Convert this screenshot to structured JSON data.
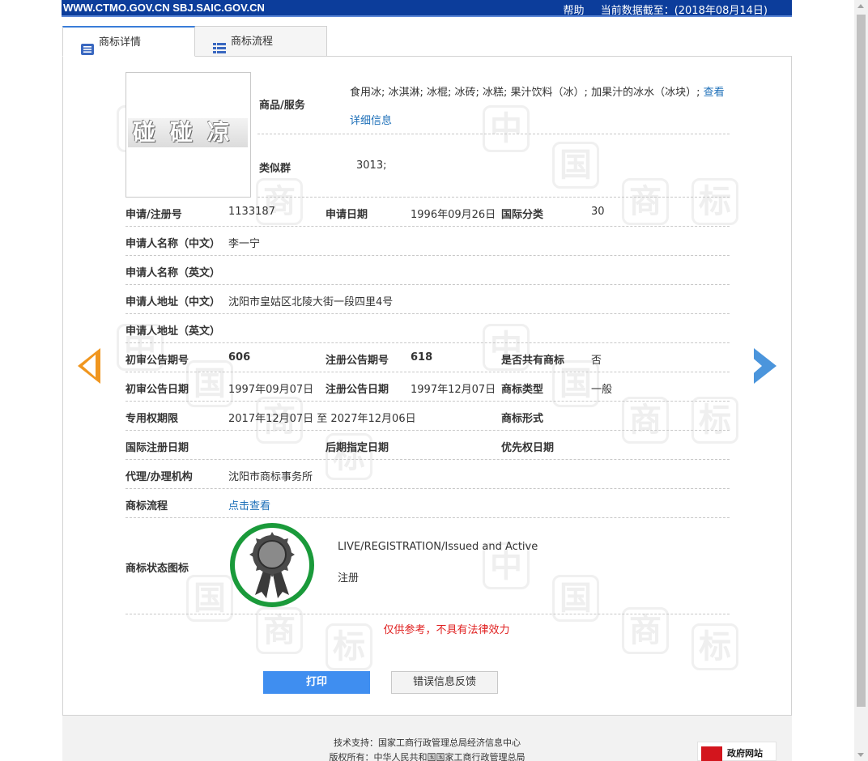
{
  "header": {
    "sites": "WWW.CTMO.GOV.CN SBJ.SAIC.GOV.CN",
    "help": "帮助",
    "data_date": "当前数据截至：(2018年08月14日)"
  },
  "tabs": [
    {
      "label": "商标详情"
    },
    {
      "label": "商标流程"
    }
  ],
  "trademark": {
    "image_text": "碰碰凉",
    "goods_label": "商品/服务",
    "goods_value": "食用冰; 冰淇淋; 冰棍; 冰砖; 冰糕; 果汁饮料（冰）; 加果汁的冰水（冰块）; ",
    "goods_more": "查看详细信息",
    "similar_label": "类似群",
    "similar_value": "3013;"
  },
  "fields": {
    "reg_no_label": "申请/注册号",
    "reg_no": "1133187",
    "app_date_label": "申请日期",
    "app_date": "1996年09月26日",
    "intl_class_label": "国际分类",
    "intl_class": "30",
    "applicant_cn_label": "申请人名称（中文）",
    "applicant_cn": "李一宁",
    "applicant_en_label": "申请人名称（英文）",
    "address_cn_label": "申请人地址（中文）",
    "address_cn": "沈阳市皇姑区北陵大街一段四里4号",
    "address_en_label": "申请人地址（英文）",
    "prelim_issue_label": "初审公告期号",
    "prelim_issue": "606",
    "reg_issue_label": "注册公告期号",
    "reg_issue": "618",
    "shared_label": "是否共有商标",
    "shared": "否",
    "prelim_date_label": "初审公告日期",
    "prelim_date": "1997年09月07日",
    "reg_date_label": "注册公告日期",
    "reg_date": "1997年12月07日",
    "mark_type_label": "商标类型",
    "mark_type": "一般",
    "term_label": "专用权期限",
    "term": "2017年12月07日 至 2027年12月06日",
    "mark_form_label": "商标形式",
    "intl_reg_date_label": "国际注册日期",
    "later_date_label": "后期指定日期",
    "priority_date_label": "优先权日期",
    "agent_label": "代理/办理机构",
    "agent": "沈阳市商标事务所",
    "process_label": "商标流程",
    "process_link": "点击查看",
    "status_label": "商标状态图标",
    "status_en": "LIVE/REGISTRATION/Issued and Active",
    "status_cn": "注册"
  },
  "disclaimer": "仅供参考，不具有法律效力",
  "buttons": {
    "print": "打印",
    "feedback": "错误信息反馈"
  },
  "footer": {
    "support": "技术支持：国家工商行政管理总局经济信息中心",
    "copyright": "版权所有：中华人民共和国国家工商行政管理总局",
    "gov_badge": "政府网站"
  },
  "watermark_chars": [
    "中",
    "国",
    "商",
    "标"
  ],
  "colors": {
    "header_bg": "#0c3d9b",
    "accent_blue": "#3f8ef0",
    "link": "#1d6fb8",
    "status_green": "#1a9a3a",
    "disclaimer_red": "#e02020",
    "arrow_left": "#f0961f",
    "arrow_right": "#4b95dc"
  }
}
